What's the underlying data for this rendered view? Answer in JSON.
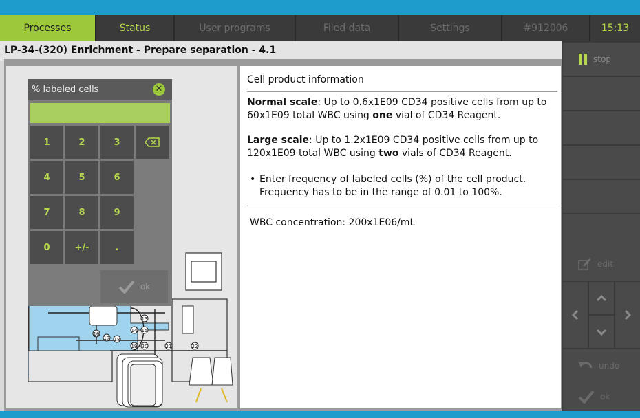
{
  "tabs": [
    {
      "label": "Processes",
      "state": "active"
    },
    {
      "label": "Status",
      "state": "highlight"
    },
    {
      "label": "User programs",
      "state": "disabled"
    },
    {
      "label": "Filed data",
      "state": "disabled"
    },
    {
      "label": "Settings",
      "state": "disabled"
    },
    {
      "label": "#912006",
      "state": "disabled"
    },
    {
      "label": "15:13",
      "state": "clock"
    }
  ],
  "title": "LP-34-(320) Enrichment - Prepare separation - 4.1",
  "keypad": {
    "title": "% labeled cells",
    "value": "",
    "keys": [
      "1",
      "2",
      "3",
      "4",
      "5",
      "6",
      "7",
      "8",
      "9",
      "0",
      "+/-",
      "."
    ],
    "ok_label": "ok"
  },
  "info": {
    "heading": "Cell product information",
    "normal_bold": "Normal scale",
    "normal_text_a": ": Up to 0.6x1E09 CD34 positive cells from up to 60x1E09 total WBC using ",
    "normal_emph": "one",
    "normal_text_b": " vial of CD34 Reagent.",
    "large_bold": "Large scale",
    "large_text_a": ": Up to 1.2x1E09 CD34 positive cells from up to 120x1E09 total WBC using ",
    "large_emph": "two",
    "large_text_b": " vials of CD34 Reagent.",
    "bullet": "Enter frequency of labeled cells (%) of the cell product. Frequency has to be in the range of 0.01 to 100%.",
    "wbc": "WBC concentration: 200x1E06/mL"
  },
  "sidebar": {
    "stop": "stop",
    "edit": "edit",
    "undo": "undo",
    "ok": "ok"
  },
  "diagram_labels": [
    "13",
    "14",
    "15",
    "16",
    "17",
    "18",
    "19",
    "20",
    "21",
    "22"
  ],
  "colors": {
    "accent": "#9dc83c",
    "header": "#1b9ccb",
    "tube_fill": "#9fd3ee"
  }
}
